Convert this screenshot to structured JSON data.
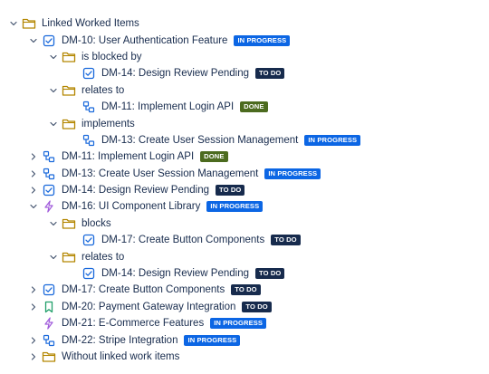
{
  "tree": {
    "root": {
      "label": "Linked Worked Items"
    },
    "rows": [
      {
        "depth": 1,
        "chevron": "down",
        "icon": "story-checkbox-icon",
        "label": "DM-10: User Authentication Feature",
        "status": "IN PROGRESS"
      },
      {
        "depth": 2,
        "chevron": "down",
        "icon": "folder-icon",
        "label": "is blocked by"
      },
      {
        "depth": 3,
        "chevron": "none",
        "icon": "story-checkbox-icon",
        "label": "DM-14: Design Review Pending",
        "status": "TO DO"
      },
      {
        "depth": 2,
        "chevron": "down",
        "icon": "folder-icon",
        "label": "relates to"
      },
      {
        "depth": 3,
        "chevron": "none",
        "icon": "subtask-icon",
        "label": "DM-11: Implement Login API",
        "status": "DONE"
      },
      {
        "depth": 2,
        "chevron": "down",
        "icon": "folder-icon",
        "label": "implements"
      },
      {
        "depth": 3,
        "chevron": "none",
        "icon": "subtask-icon",
        "label": "DM-13: Create User Session Management",
        "status": "IN PROGRESS"
      },
      {
        "depth": 1,
        "chevron": "right",
        "icon": "subtask-icon",
        "label": "DM-11: Implement Login API",
        "status": "DONE"
      },
      {
        "depth": 1,
        "chevron": "right",
        "icon": "subtask-icon",
        "label": "DM-13: Create User Session Management",
        "status": "IN PROGRESS"
      },
      {
        "depth": 1,
        "chevron": "right",
        "icon": "story-checkbox-icon",
        "label": "DM-14: Design Review Pending",
        "status": "TO DO"
      },
      {
        "depth": 1,
        "chevron": "down",
        "icon": "epic-lightning-icon",
        "label": "DM-16: UI Component Library",
        "status": "IN PROGRESS"
      },
      {
        "depth": 2,
        "chevron": "down",
        "icon": "folder-icon",
        "label": "blocks"
      },
      {
        "depth": 3,
        "chevron": "none",
        "icon": "story-checkbox-icon",
        "label": "DM-17: Create Button Components",
        "status": "TO DO"
      },
      {
        "depth": 2,
        "chevron": "down",
        "icon": "folder-icon",
        "label": "relates to"
      },
      {
        "depth": 3,
        "chevron": "none",
        "icon": "story-checkbox-icon",
        "label": "DM-14: Design Review Pending",
        "status": "TO DO"
      },
      {
        "depth": 1,
        "chevron": "right",
        "icon": "story-checkbox-icon",
        "label": "DM-17: Create Button Components",
        "status": "TO DO"
      },
      {
        "depth": 1,
        "chevron": "right",
        "icon": "bookmark-icon",
        "label": "DM-20: Payment Gateway Integration",
        "status": "TO DO"
      },
      {
        "depth": 1,
        "chevron": "none",
        "icon": "epic-lightning-icon",
        "label": "DM-21: E-Commerce Features",
        "status": "IN PROGRESS"
      },
      {
        "depth": 1,
        "chevron": "right",
        "icon": "subtask-icon",
        "label": "DM-22: Stripe Integration",
        "status": "IN PROGRESS"
      },
      {
        "depth": 1,
        "chevron": "right",
        "icon": "folder-icon",
        "label": "Without linked work items"
      }
    ]
  },
  "colors": {
    "text": "#172b4d",
    "chevron": "#44546f",
    "folder": "#b38600",
    "story": "#1868db",
    "subtask": "#1868db",
    "epic": "#a05bdb",
    "bookmark": "#22a06b",
    "in_progress": "#0c66e4",
    "to_do": "#172b4d",
    "done": "#4c6b1f"
  }
}
